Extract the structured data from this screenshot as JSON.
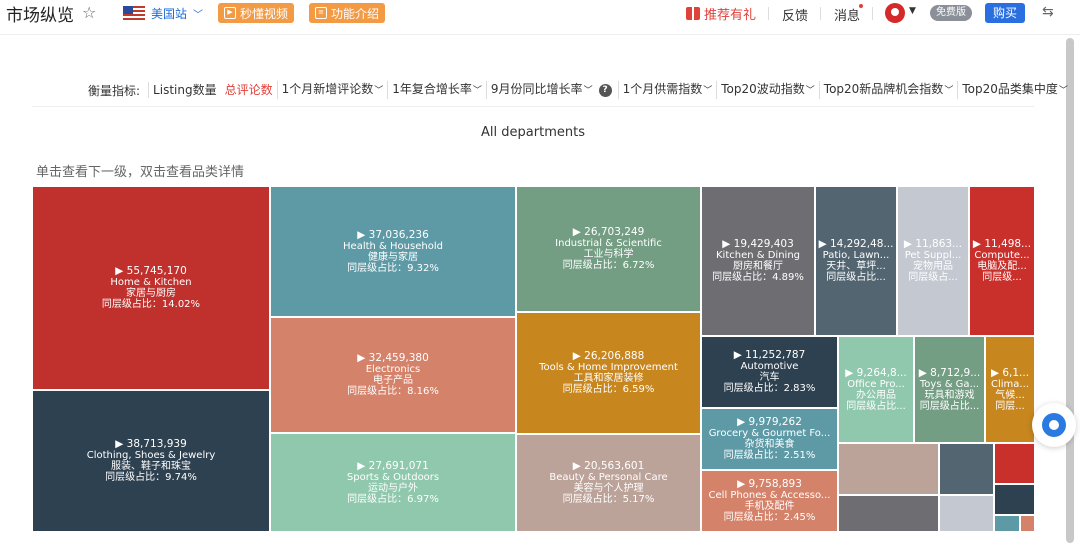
{
  "header": {
    "title": "市场纵览",
    "site": "美国站",
    "video_btn": "秒懂视频",
    "intro_btn": "功能介绍",
    "recommend": "推荐有礼",
    "feedback": "反馈",
    "messages": "消息",
    "plan_badge": "免费版",
    "buy": "购买"
  },
  "metrics": {
    "label": "衡量指标:",
    "items": [
      {
        "text": "Listing数量",
        "active": false,
        "dropdown": false
      },
      {
        "text": "总评论数",
        "active": true,
        "dropdown": false
      },
      {
        "text": "1个月新增评论数",
        "active": false,
        "dropdown": true
      },
      {
        "text": "1年复合增长率",
        "active": false,
        "dropdown": true
      },
      {
        "text": "9月份同比增长率",
        "active": false,
        "dropdown": true,
        "help": true
      },
      {
        "text": "1个月供需指数",
        "active": false,
        "dropdown": true
      },
      {
        "text": "Top20波动指数",
        "active": false,
        "dropdown": true
      },
      {
        "text": "Top20新品牌机会指数",
        "active": false,
        "dropdown": true
      },
      {
        "text": "Top20品类集中度",
        "active": false,
        "dropdown": true
      }
    ]
  },
  "chart_title": "All departments",
  "hint": "单击查看下一级，双击查看品类详情",
  "tiles": [
    {
      "value": "▶ 55,745,170",
      "name": "Home & Kitchen",
      "cn": "家居与厨房",
      "share": "同层级占比：14.02%",
      "color": "#c0302c"
    },
    {
      "value": "▶ 38,713,939",
      "name": "Clothing, Shoes & Jewelry",
      "cn": "服装、鞋子和珠宝",
      "share": "同层级占比：9.74%",
      "color": "#2e4150"
    },
    {
      "value": "▶ 37,036,236",
      "name": "Health & Household",
      "cn": "健康与家居",
      "share": "同层级占比：9.32%",
      "color": "#5e9aa6"
    },
    {
      "value": "▶ 32,459,380",
      "name": "Electronics",
      "cn": "电子产品",
      "share": "同层级占比：8.16%",
      "color": "#d4826a"
    },
    {
      "value": "▶ 27,691,071",
      "name": "Sports & Outdoors",
      "cn": "运动与户外",
      "share": "同层级占比：6.97%",
      "color": "#8fc8ad"
    },
    {
      "value": "▶ 26,703,249",
      "name": "Industrial & Scientific",
      "cn": "工业与科学",
      "share": "同层级占比：6.72%",
      "color": "#749e83"
    },
    {
      "value": "▶ 26,206,888",
      "name": "Tools & Home Improvement",
      "cn": "工具和家居装修",
      "share": "同层级占比：6.59%",
      "color": "#c7861e"
    },
    {
      "value": "▶ 20,563,601",
      "name": "Beauty & Personal Care",
      "cn": "美容与个人护理",
      "share": "同层级占比：5.17%",
      "color": "#bca39a"
    },
    {
      "value": "▶ 19,429,403",
      "name": "Kitchen & Dining",
      "cn": "厨房和餐厅",
      "share": "同层级占比：4.89%",
      "color": "#6e6e72"
    },
    {
      "value": "▶ 14,292,48...",
      "name": "Patio, Lawn...",
      "cn": "天井、草坪...",
      "share": "同层级占比...",
      "color": "#536570"
    },
    {
      "value": "▶ 11,863...",
      "name": "Pet Suppl...",
      "cn": "宠物用品",
      "share": "同层级占...",
      "color": "#c4c8d0"
    },
    {
      "value": "▶ 11,498...",
      "name": "Compute...",
      "cn": "电脑及配...",
      "share": "同层级...",
      "color": "#c9302c"
    },
    {
      "value": "▶ 11,252,787",
      "name": "Automotive",
      "cn": "汽车",
      "share": "同层级占比：2.83%",
      "color": "#2e4150"
    },
    {
      "value": "▶ 9,979,262",
      "name": "Grocery & Gourmet Fo...",
      "cn": "杂货和美食",
      "share": "同层级占比：2.51%",
      "color": "#5e9aa6"
    },
    {
      "value": "▶ 9,758,893",
      "name": "Cell Phones & Accesso...",
      "cn": "手机及配件",
      "share": "同层级占比：2.45%",
      "color": "#d4826a"
    },
    {
      "value": "▶ 9,264,8...",
      "name": "Office Pro...",
      "cn": "办公用品",
      "share": "同层级占比...",
      "color": "#8fc8ad"
    },
    {
      "value": "▶ 8,712,9...",
      "name": "Toys & Ga...",
      "cn": "玩具和游戏",
      "share": "同层级占比...",
      "color": "#749e83"
    },
    {
      "value": "▶ 6,1...",
      "name": "Clima...",
      "cn": "气候...",
      "share": "同层...",
      "color": "#c7861e"
    },
    {
      "value": "",
      "name": "",
      "cn": "",
      "share": "",
      "color": "#bca39a"
    },
    {
      "value": "",
      "name": "",
      "cn": "",
      "share": "",
      "color": "#6e6e72"
    },
    {
      "value": "",
      "name": "",
      "cn": "",
      "share": "",
      "color": "#536570"
    },
    {
      "value": "",
      "name": "",
      "cn": "",
      "share": "",
      "color": "#c4c8d0"
    },
    {
      "value": "",
      "name": "",
      "cn": "",
      "share": "",
      "color": "#c9302c"
    },
    {
      "value": "",
      "name": "",
      "cn": "",
      "share": "",
      "color": "#2e4150"
    },
    {
      "value": "",
      "name": "",
      "cn": "",
      "share": "",
      "color": "#5e9aa6"
    },
    {
      "value": "",
      "name": "",
      "cn": "",
      "share": "",
      "color": "#d4826a"
    }
  ]
}
